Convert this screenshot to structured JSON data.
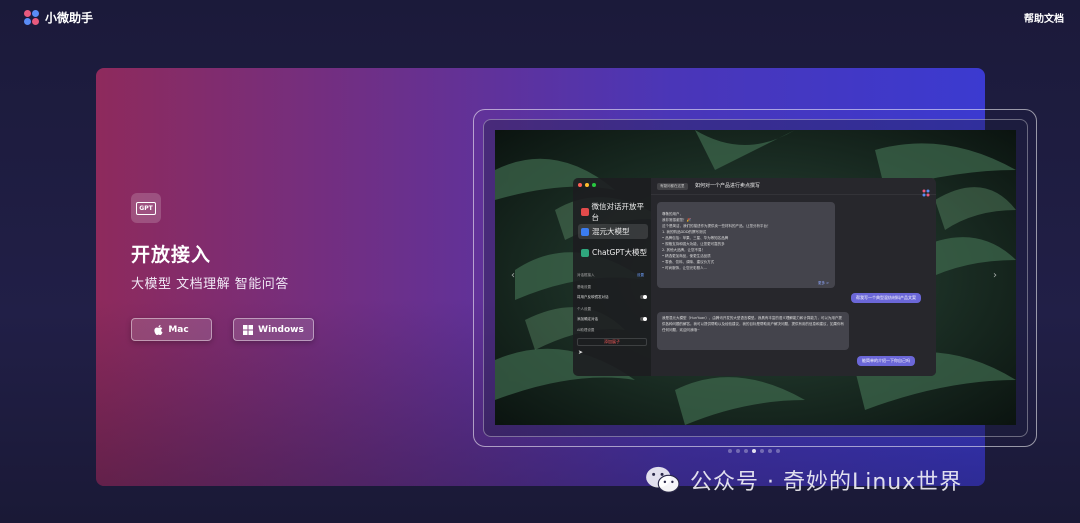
{
  "app": {
    "name": "小微助手"
  },
  "header": {
    "help_label": "帮助文档"
  },
  "hero": {
    "badge": "GPT",
    "title": "开放接入",
    "subtitle": "大模型 文档理解 智能问答",
    "mac_label": "Mac",
    "windows_label": "Windows"
  },
  "screenshot": {
    "prev_arrow": "‹",
    "next_arrow": "›",
    "platforms": [
      {
        "label": "微信对话开放平台",
        "icon": "wechat-open-icon",
        "color": "#e24b4b",
        "active": false
      },
      {
        "label": "混元大模型",
        "icon": "hunyuan-icon",
        "color": "#3b7cf0",
        "active": true
      },
      {
        "label": "ChatGPT大模型",
        "icon": "chatgpt-icon",
        "color": "#2fa67d",
        "active": false
      }
    ],
    "sidebar": {
      "section1": "对话框接入",
      "section1_link": "设置",
      "line1": "基础设置",
      "line2": "将用户反映镜发对话",
      "line3": "个人设置",
      "line4": "添加确定对话",
      "line5": "AI助理设置",
      "add_button": "添加展子"
    },
    "chat": {
      "tag": "有疑问都在这里",
      "title": "如何对一个产品进行卖点撰写",
      "reply1": "尊敬的用户，\n我非常感谢您！🎉\n这个是简洁，我们的描述作为提供卖一些材料的产品。让您分析平台！\n1. 我的购品DDD的撰写测试\n   • 品牌包括：苹果、三星、华为等知名品牌\n   • 规格支持和强大功能，让您更可靠的多\n2. 其他大品牌，让您不易！\n   • 精选更加商品，使更生活品质\n   • 零食、饮料、调味、建议价方式\n   • 时尚服饰，让您光彩照人...",
      "more": "更多 >",
      "user1": "帮我写一个典型混纺材料产品文案",
      "reply2": "我是混元大模型（HunYuan），由腾讯开发的大型语言模型。我具有丰富的语义理解能力和计算能力，可以为用户提供各种问题的解答。我可以提供帮助以及经验建议，我的目标是帮助用户解决问题，提供有用的信息和建议，如果你有任何问题，欢迎问我哦~",
      "user2": "能简单的介绍一下你自己吗"
    }
  },
  "carousel": {
    "total": 7,
    "active_index": 3
  },
  "watermark": {
    "text": "公众号 · 奇妙的Linux世界"
  },
  "colors": {
    "hero_left": "#8e2a5c",
    "hero_right": "#3b3ad0",
    "accent_purple": "#6b67d8"
  }
}
